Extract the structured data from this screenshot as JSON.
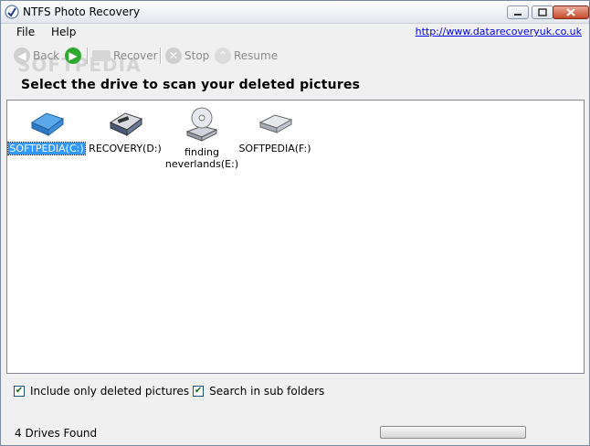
{
  "window": {
    "title": "NTFS Photo Recovery"
  },
  "menu": {
    "file": "File",
    "help": "Help",
    "link": "http://www.datarecoveryuk.co.uk"
  },
  "toolbar": {
    "back": "Back",
    "recover": "Recover",
    "stop": "Stop",
    "resume": "Resume"
  },
  "heading": "Select the drive to scan your deleted pictures",
  "drives": [
    {
      "label": "SOFTPEDIA(C:)",
      "selected": true,
      "icon": "hard-drive-blue-icon"
    },
    {
      "label": "RECOVERY(D:)",
      "selected": false,
      "icon": "hard-drive-removable-icon"
    },
    {
      "label": "finding neverlands(E:)",
      "selected": false,
      "icon": "cd-drive-icon"
    },
    {
      "label": "SOFTPEDIA(F:)",
      "selected": false,
      "icon": "hard-drive-gray-icon"
    }
  ],
  "options": [
    {
      "label": "Include only deleted pictures",
      "checked": true
    },
    {
      "label": "Search in sub folders",
      "checked": true
    }
  ],
  "status": {
    "text": "4 Drives Found",
    "progress": 0
  },
  "watermark": "SOFTPEDIA",
  "colors": {
    "selection": "#3399ff",
    "link": "#0000ee"
  }
}
